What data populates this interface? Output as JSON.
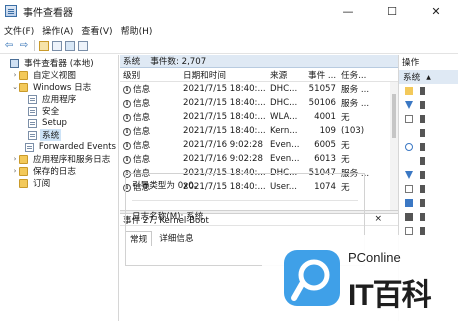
{
  "window": {
    "title": "事件查看器",
    "minimize": "—",
    "maximize": "☐",
    "close": "✕"
  },
  "menu": [
    "文件(F)",
    "操作(A)",
    "查看(V)",
    "帮助(H)"
  ],
  "toolbar": {
    "back": "⇦",
    "forward": "⇨"
  },
  "tree": {
    "items": [
      {
        "label": "事件查看器 (本地)",
        "indent": 0,
        "icon": "computer-icon",
        "twisty": ""
      },
      {
        "label": "自定义视图",
        "indent": 1,
        "icon": "folder-icon",
        "twisty": "›"
      },
      {
        "label": "Windows 日志",
        "indent": 1,
        "icon": "folder-icon",
        "twisty": "⌄"
      },
      {
        "label": "应用程序",
        "indent": 2,
        "icon": "log-icon",
        "twisty": ""
      },
      {
        "label": "安全",
        "indent": 2,
        "icon": "log-icon",
        "twisty": ""
      },
      {
        "label": "Setup",
        "indent": 2,
        "icon": "log-icon",
        "twisty": ""
      },
      {
        "label": "系统",
        "indent": 2,
        "icon": "log-icon",
        "twisty": "",
        "selected": true
      },
      {
        "label": "Forwarded Events",
        "indent": 2,
        "icon": "log-icon",
        "twisty": ""
      },
      {
        "label": "应用程序和服务日志",
        "indent": 1,
        "icon": "folder-icon",
        "twisty": "›"
      },
      {
        "label": "保存的日志",
        "indent": 1,
        "icon": "folder-icon",
        "twisty": "›"
      },
      {
        "label": "订阅",
        "indent": 1,
        "icon": "folder-icon",
        "twisty": ""
      }
    ]
  },
  "log_header": {
    "name": "系统",
    "count": "事件数: 2,707"
  },
  "grid": {
    "columns": [
      "级别",
      "日期和时间",
      "来源",
      "事件 ...",
      "任务..."
    ],
    "rows": [
      [
        "信息",
        "2021/7/15 18:40:...",
        "DHC...",
        "51057",
        "服务 ..."
      ],
      [
        "信息",
        "2021/7/15 18:40:...",
        "DHC...",
        "50106",
        "服务 ..."
      ],
      [
        "信息",
        "2021/7/15 18:40:...",
        "WLA...",
        "4001",
        "无"
      ],
      [
        "信息",
        "2021/7/15 18:40:...",
        "Kern...",
        "109",
        "(103)"
      ],
      [
        "信息",
        "2021/7/16 9:02:28",
        "Even...",
        "6005",
        "无"
      ],
      [
        "信息",
        "2021/7/16 9:02:28",
        "Even...",
        "6013",
        "无"
      ],
      [
        "信息",
        "2021/7/15 18:40:...",
        "DHC...",
        "51047",
        "服务 ..."
      ],
      [
        "信息",
        "2021/7/15 18:40:...",
        "User...",
        "1074",
        "无"
      ]
    ]
  },
  "detail": {
    "header": "事件 27, Kernel-Boot",
    "close": "×",
    "tabs": [
      "常规",
      "详细信息"
    ],
    "line1": "引导类型为 0x0。",
    "line2": "日志名称(M):   系统"
  },
  "actions": {
    "title": "操作",
    "section": "系统",
    "section_chevron": "▲"
  },
  "watermark": {
    "small": "PConline",
    "brand": "IT百科"
  },
  "colors": {
    "selection": "#cde3f7",
    "header_band": "#dfe9f4",
    "watermark_blue": "#3fa0e8"
  }
}
